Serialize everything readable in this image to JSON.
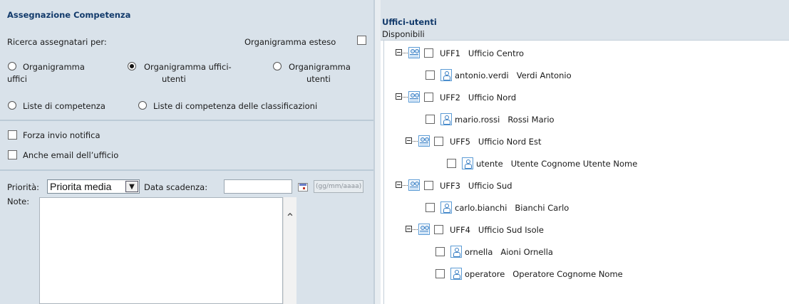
{
  "left": {
    "title": "Assegnazione Competenza",
    "search_label": "Ricerca assegnatari per:",
    "organigramma_esteso": "Organigramma esteso",
    "radios": {
      "uffici_l1": "Organigramma",
      "uffici_l2": "uffici",
      "uffici_utenti_l1": "Organigramma uffici-",
      "uffici_utenti_l2": "utenti",
      "utenti_l1": "Organigramma",
      "utenti_l2": "utenti",
      "liste": "Liste di competenza",
      "liste_class": "Liste di competenza delle classificazioni"
    },
    "forza_invio": "Forza invio notifica",
    "anche_email": "Anche email dell’ufficio",
    "priorita_label": "Priorità:",
    "priorita_value": "Priorita media",
    "data_scadenza_label": "Data scadenza:",
    "date_placeholder": "(gg/mm/aaaa)",
    "note_label": "Note:"
  },
  "right": {
    "title": "Uffici-utenti",
    "subtitle": "Disponibili",
    "tree": [
      {
        "code": "UFF1",
        "name": "Ufficio Centro"
      },
      {
        "user": "antonio.verdi",
        "fullname": "Verdi Antonio"
      },
      {
        "code": "UFF2",
        "name": "Ufficio Nord"
      },
      {
        "user": "mario.rossi",
        "fullname": "Rossi Mario"
      },
      {
        "code": "UFF5",
        "name": "Ufficio Nord Est"
      },
      {
        "user": "utente",
        "fullname": "Utente Cognome Utente Nome"
      },
      {
        "code": "UFF3",
        "name": "Ufficio Sud"
      },
      {
        "user": "carlo.bianchi",
        "fullname": "Bianchi Carlo"
      },
      {
        "code": "UFF4",
        "name": "Ufficio Sud Isole"
      },
      {
        "user": "ornella",
        "fullname": "Aioni Ornella"
      },
      {
        "user": "operatore",
        "fullname": "Operatore Cognome Nome"
      }
    ]
  }
}
